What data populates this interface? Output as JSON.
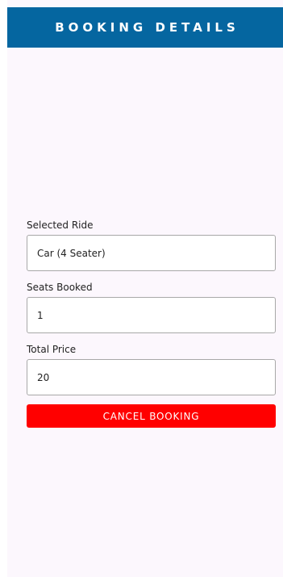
{
  "header": {
    "title": "BOOKING DETAILS"
  },
  "fields": [
    {
      "label": "Selected Ride",
      "value": "Car (4 Seater)"
    },
    {
      "label": "Seats Booked",
      "value": "1"
    },
    {
      "label": "Total Price",
      "value": "20"
    }
  ],
  "actions": {
    "cancel_label": "CANCEL BOOKING"
  },
  "colors": {
    "header_bg": "#0566a0",
    "page_bg": "#fcf7fd",
    "cancel_bg": "#ff0000"
  }
}
